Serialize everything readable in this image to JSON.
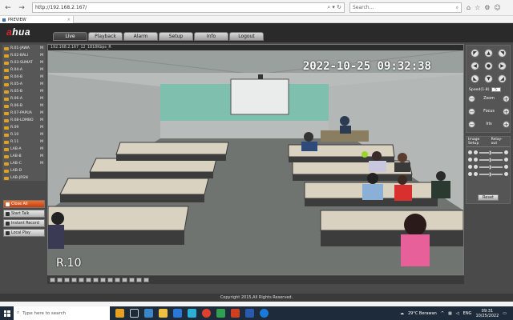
{
  "browser": {
    "url": "http://192.168.2.167/",
    "search_placeholder": "Search...",
    "tab_title": "PREVIEW"
  },
  "app": {
    "logo_pre": "a",
    "logo_post": "hua",
    "tabs": [
      "Live",
      "Playback",
      "Alarm",
      "Setup",
      "Info",
      "Logout"
    ],
    "active_tab": "Live"
  },
  "cameras": [
    {
      "label": "R.01-JAWA",
      "flag": "M"
    },
    {
      "label": "R.02-BALI",
      "flag": "M"
    },
    {
      "label": "R.03-SUMAT",
      "flag": "M"
    },
    {
      "label": "R.04-A",
      "flag": "M"
    },
    {
      "label": "R.04-B",
      "flag": "M"
    },
    {
      "label": "R.05-A",
      "flag": "M"
    },
    {
      "label": "R.05-B",
      "flag": "M"
    },
    {
      "label": "R.06-A",
      "flag": "M"
    },
    {
      "label": "R.06-B",
      "flag": "M"
    },
    {
      "label": "R.07-PAPUA",
      "flag": "M"
    },
    {
      "label": "R.08-LOMBO",
      "flag": "M"
    },
    {
      "label": "R.09",
      "flag": "M"
    },
    {
      "label": "R.10",
      "flag": "M"
    },
    {
      "label": "R.11",
      "flag": "M"
    },
    {
      "label": "LAB-A",
      "flag": "M"
    },
    {
      "label": "LAB-B",
      "flag": "M"
    },
    {
      "label": "LAB-C",
      "flag": "M"
    },
    {
      "label": "LAB-D",
      "flag": ""
    },
    {
      "label": "LAB-JRSN",
      "flag": ""
    }
  ],
  "left_buttons": {
    "close_all": "Close All",
    "start_talk": "Start Talk",
    "instant_record": "Instant Record",
    "local_play": "Local Play"
  },
  "video": {
    "header": "192.168.2.167_12_1818Kbps_R",
    "timestamp": "2022-10-25  09:32:38",
    "channel_name": "R.10"
  },
  "ptz": {
    "speed_label": "Speed(1-8)",
    "speed_value": "5",
    "zoom_label": "Zoom",
    "focus_label": "Focus",
    "iris_label": "Iris"
  },
  "image_setup": {
    "tab_1": "Image Setup",
    "tab_2": "Relay-out",
    "reset_label": "Reset"
  },
  "footer": "Copyright 2015,All Rights Reserved.",
  "taskbar": {
    "search_text": "Type here to search",
    "weather": "29°C  Berawan",
    "lang": "ENG",
    "time": "09:31",
    "date": "10/25/2022"
  }
}
